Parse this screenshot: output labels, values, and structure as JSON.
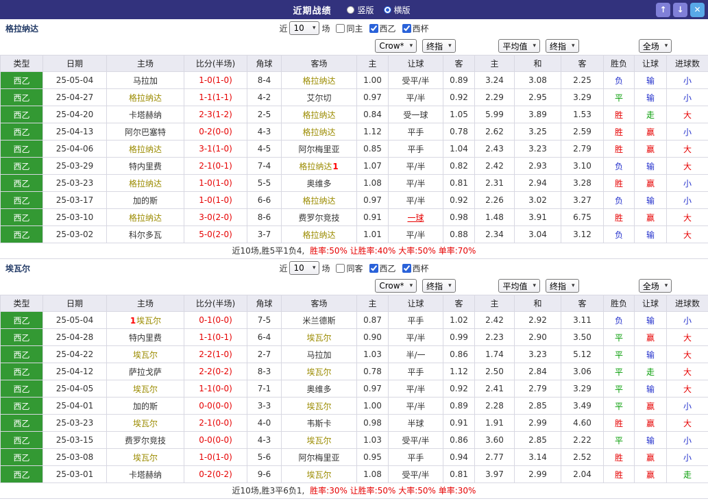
{
  "titlebar": {
    "title": "近期战绩",
    "radios": [
      {
        "label": "竖版",
        "selected": false
      },
      {
        "label": "横版",
        "selected": true
      }
    ]
  },
  "icons": {
    "up": "↑",
    "down": "↓",
    "close": "✕",
    "dropdown": "▾"
  },
  "labels": {
    "near": "近",
    "games": "场"
  },
  "selects": {
    "count": "10",
    "bookmaker": "Crow*",
    "ah_time": "终指",
    "eu_source": "平均值",
    "eu_time": "终指",
    "scope": "全场"
  },
  "columns": [
    "类型",
    "日期",
    "主场",
    "比分(半场)",
    "角球",
    "客场",
    "主",
    "让球",
    "客",
    "主",
    "和",
    "客",
    "胜负",
    "让球",
    "进球数"
  ],
  "colors": {
    "titlebar_bg": "#32327d",
    "league_badge_bg": "#339933",
    "score_red": "#e60000",
    "self_team": "#9b8b00",
    "status": {
      "胜": "#e60000",
      "平": "#009b00",
      "负": "#2330cc",
      "赢": "#e60000",
      "输": "#2330cc",
      "走": "#009b00",
      "大": "#e60000",
      "小": "#2330cc"
    }
  },
  "sections": [
    {
      "team": "格拉纳达",
      "filters": {
        "same": {
          "label": "同主",
          "checked": false
        },
        "league": {
          "label": "西乙",
          "checked": true
        },
        "cup": {
          "label": "西杯",
          "checked": true
        }
      },
      "rows": [
        {
          "league": "西乙",
          "date": "25-05-04",
          "home": "马拉加",
          "home_self": false,
          "score": "1-0(1-0)",
          "corner": "8-4",
          "away": "格拉纳达",
          "away_self": true,
          "ah_home": "1.00",
          "ah_line": "受平/半",
          "ah_line_red": false,
          "ah_away": "0.89",
          "eu_home": "3.24",
          "eu_draw": "3.08",
          "eu_away": "2.25",
          "result": "负",
          "handicap": "输",
          "goals": "小"
        },
        {
          "league": "西乙",
          "date": "25-04-27",
          "home": "格拉纳达",
          "home_self": true,
          "score": "1-1(1-1)",
          "corner": "4-2",
          "away": "艾尔切",
          "away_self": false,
          "ah_home": "0.97",
          "ah_line": "平/半",
          "ah_line_red": false,
          "ah_away": "0.92",
          "eu_home": "2.29",
          "eu_draw": "2.95",
          "eu_away": "3.29",
          "result": "平",
          "handicap": "输",
          "goals": "小"
        },
        {
          "league": "西乙",
          "date": "25-04-20",
          "home": "卡塔赫纳",
          "home_self": false,
          "score": "2-3(1-2)",
          "corner": "2-5",
          "away": "格拉纳达",
          "away_self": true,
          "ah_home": "0.84",
          "ah_line": "受一球",
          "ah_line_red": false,
          "ah_away": "1.05",
          "eu_home": "5.99",
          "eu_draw": "3.89",
          "eu_away": "1.53",
          "result": "胜",
          "handicap": "走",
          "goals": "大"
        },
        {
          "league": "西乙",
          "date": "25-04-13",
          "home": "阿尔巴塞特",
          "home_self": false,
          "score": "0-2(0-0)",
          "corner": "4-3",
          "away": "格拉纳达",
          "away_self": true,
          "ah_home": "1.12",
          "ah_line": "平手",
          "ah_line_red": false,
          "ah_away": "0.78",
          "eu_home": "2.62",
          "eu_draw": "3.25",
          "eu_away": "2.59",
          "result": "胜",
          "handicap": "赢",
          "goals": "小"
        },
        {
          "league": "西乙",
          "date": "25-04-06",
          "home": "格拉纳达",
          "home_self": true,
          "score": "3-1(1-0)",
          "corner": "4-5",
          "away": "阿尔梅里亚",
          "away_self": false,
          "ah_home": "0.85",
          "ah_line": "平手",
          "ah_line_red": false,
          "ah_away": "1.04",
          "eu_home": "2.43",
          "eu_draw": "3.23",
          "eu_away": "2.79",
          "result": "胜",
          "handicap": "赢",
          "goals": "大"
        },
        {
          "league": "西乙",
          "date": "25-03-29",
          "home": "特内里费",
          "home_self": false,
          "score": "2-1(0-1)",
          "corner": "7-4",
          "away": "格拉纳达",
          "away_self": true,
          "away_mark_after": "1",
          "ah_home": "1.07",
          "ah_line": "平/半",
          "ah_line_red": false,
          "ah_away": "0.82",
          "eu_home": "2.42",
          "eu_draw": "2.93",
          "eu_away": "3.10",
          "result": "负",
          "handicap": "输",
          "goals": "大"
        },
        {
          "league": "西乙",
          "date": "25-03-23",
          "home": "格拉纳达",
          "home_self": true,
          "score": "1-0(1-0)",
          "corner": "5-5",
          "away": "奥维多",
          "away_self": false,
          "ah_home": "1.08",
          "ah_line": "平/半",
          "ah_line_red": false,
          "ah_away": "0.81",
          "eu_home": "2.31",
          "eu_draw": "2.94",
          "eu_away": "3.28",
          "result": "胜",
          "handicap": "赢",
          "goals": "小"
        },
        {
          "league": "西乙",
          "date": "25-03-17",
          "home": "加的斯",
          "home_self": false,
          "score": "1-0(1-0)",
          "corner": "6-6",
          "away": "格拉纳达",
          "away_self": true,
          "ah_home": "0.97",
          "ah_line": "平/半",
          "ah_line_red": false,
          "ah_away": "0.92",
          "eu_home": "2.26",
          "eu_draw": "3.02",
          "eu_away": "3.27",
          "result": "负",
          "handicap": "输",
          "goals": "小"
        },
        {
          "league": "西乙",
          "date": "25-03-10",
          "home": "格拉纳达",
          "home_self": true,
          "score": "3-0(2-0)",
          "corner": "8-6",
          "away": "费罗尔竞技",
          "away_self": false,
          "ah_home": "0.91",
          "ah_line": "一球",
          "ah_line_red": true,
          "ah_away": "0.98",
          "eu_home": "1.48",
          "eu_draw": "3.91",
          "eu_away": "6.75",
          "result": "胜",
          "handicap": "赢",
          "goals": "大"
        },
        {
          "league": "西乙",
          "date": "25-03-02",
          "home": "科尔多瓦",
          "home_self": false,
          "score": "5-0(2-0)",
          "corner": "3-7",
          "away": "格拉纳达",
          "away_self": true,
          "ah_home": "1.01",
          "ah_line": "平/半",
          "ah_line_red": false,
          "ah_away": "0.88",
          "eu_home": "2.34",
          "eu_draw": "3.04",
          "eu_away": "3.12",
          "result": "负",
          "handicap": "输",
          "goals": "大"
        }
      ],
      "summary": {
        "plain": "近10场,胜5平1负4,",
        "highlight": "胜率:50% 让胜率:40% 大率:50% 单率:70%"
      }
    },
    {
      "team": "埃瓦尔",
      "filters": {
        "same": {
          "label": "同客",
          "checked": false
        },
        "league": {
          "label": "西乙",
          "checked": true
        },
        "cup": {
          "label": "西杯",
          "checked": true
        }
      },
      "rows": [
        {
          "league": "西乙",
          "date": "25-05-04",
          "home": "埃瓦尔",
          "home_self": true,
          "home_mark_before": "1",
          "score": "0-1(0-0)",
          "corner": "7-5",
          "away": "米兰德斯",
          "away_self": false,
          "ah_home": "0.87",
          "ah_line": "平手",
          "ah_line_red": false,
          "ah_away": "1.02",
          "eu_home": "2.42",
          "eu_draw": "2.92",
          "eu_away": "3.11",
          "result": "负",
          "handicap": "输",
          "goals": "小"
        },
        {
          "league": "西乙",
          "date": "25-04-28",
          "home": "特内里费",
          "home_self": false,
          "score": "1-1(0-1)",
          "corner": "6-4",
          "away": "埃瓦尔",
          "away_self": true,
          "ah_home": "0.90",
          "ah_line": "平/半",
          "ah_line_red": false,
          "ah_away": "0.99",
          "eu_home": "2.23",
          "eu_draw": "2.90",
          "eu_away": "3.50",
          "result": "平",
          "handicap": "赢",
          "goals": "大"
        },
        {
          "league": "西乙",
          "date": "25-04-22",
          "home": "埃瓦尔",
          "home_self": true,
          "score": "2-2(1-0)",
          "corner": "2-7",
          "away": "马拉加",
          "away_self": false,
          "ah_home": "1.03",
          "ah_line": "半/一",
          "ah_line_red": false,
          "ah_away": "0.86",
          "eu_home": "1.74",
          "eu_draw": "3.23",
          "eu_away": "5.12",
          "result": "平",
          "handicap": "输",
          "goals": "大"
        },
        {
          "league": "西乙",
          "date": "25-04-12",
          "home": "萨拉戈萨",
          "home_self": false,
          "score": "2-2(0-2)",
          "corner": "8-3",
          "away": "埃瓦尔",
          "away_self": true,
          "ah_home": "0.78",
          "ah_line": "平手",
          "ah_line_red": false,
          "ah_away": "1.12",
          "eu_home": "2.50",
          "eu_draw": "2.84",
          "eu_away": "3.06",
          "result": "平",
          "handicap": "走",
          "goals": "大"
        },
        {
          "league": "西乙",
          "date": "25-04-05",
          "home": "埃瓦尔",
          "home_self": true,
          "score": "1-1(0-0)",
          "corner": "7-1",
          "away": "奥维多",
          "away_self": false,
          "ah_home": "0.97",
          "ah_line": "平/半",
          "ah_line_red": false,
          "ah_away": "0.92",
          "eu_home": "2.41",
          "eu_draw": "2.79",
          "eu_away": "3.29",
          "result": "平",
          "handicap": "输",
          "goals": "大"
        },
        {
          "league": "西乙",
          "date": "25-04-01",
          "home": "加的斯",
          "home_self": false,
          "score": "0-0(0-0)",
          "corner": "3-3",
          "away": "埃瓦尔",
          "away_self": true,
          "ah_home": "1.00",
          "ah_line": "平/半",
          "ah_line_red": false,
          "ah_away": "0.89",
          "eu_home": "2.28",
          "eu_draw": "2.85",
          "eu_away": "3.49",
          "result": "平",
          "handicap": "赢",
          "goals": "小"
        },
        {
          "league": "西乙",
          "date": "25-03-23",
          "home": "埃瓦尔",
          "home_self": true,
          "score": "2-1(0-0)",
          "corner": "4-0",
          "away": "韦斯卡",
          "away_self": false,
          "ah_home": "0.98",
          "ah_line": "半球",
          "ah_line_red": false,
          "ah_away": "0.91",
          "eu_home": "1.91",
          "eu_draw": "2.99",
          "eu_away": "4.60",
          "result": "胜",
          "handicap": "赢",
          "goals": "大"
        },
        {
          "league": "西乙",
          "date": "25-03-15",
          "home": "费罗尔竞技",
          "home_self": false,
          "score": "0-0(0-0)",
          "corner": "4-3",
          "away": "埃瓦尔",
          "away_self": true,
          "ah_home": "1.03",
          "ah_line": "受平/半",
          "ah_line_red": false,
          "ah_away": "0.86",
          "eu_home": "3.60",
          "eu_draw": "2.85",
          "eu_away": "2.22",
          "result": "平",
          "handicap": "输",
          "goals": "小"
        },
        {
          "league": "西乙",
          "date": "25-03-08",
          "home": "埃瓦尔",
          "home_self": true,
          "score": "1-0(1-0)",
          "corner": "5-6",
          "away": "阿尔梅里亚",
          "away_self": false,
          "ah_home": "0.95",
          "ah_line": "平手",
          "ah_line_red": false,
          "ah_away": "0.94",
          "eu_home": "2.77",
          "eu_draw": "3.14",
          "eu_away": "2.52",
          "result": "胜",
          "handicap": "赢",
          "goals": "小"
        },
        {
          "league": "西乙",
          "date": "25-03-01",
          "home": "卡塔赫纳",
          "home_self": false,
          "score": "0-2(0-2)",
          "corner": "9-6",
          "away": "埃瓦尔",
          "away_self": true,
          "ah_home": "1.08",
          "ah_line": "受平/半",
          "ah_line_red": false,
          "ah_away": "0.81",
          "eu_home": "3.97",
          "eu_draw": "2.99",
          "eu_away": "2.04",
          "result": "胜",
          "handicap": "赢",
          "goals": "走"
        }
      ],
      "summary": {
        "plain": "近10场,胜3平6负1,",
        "highlight": "胜率:30% 让胜率:50% 大率:50% 单率:30%"
      }
    }
  ]
}
